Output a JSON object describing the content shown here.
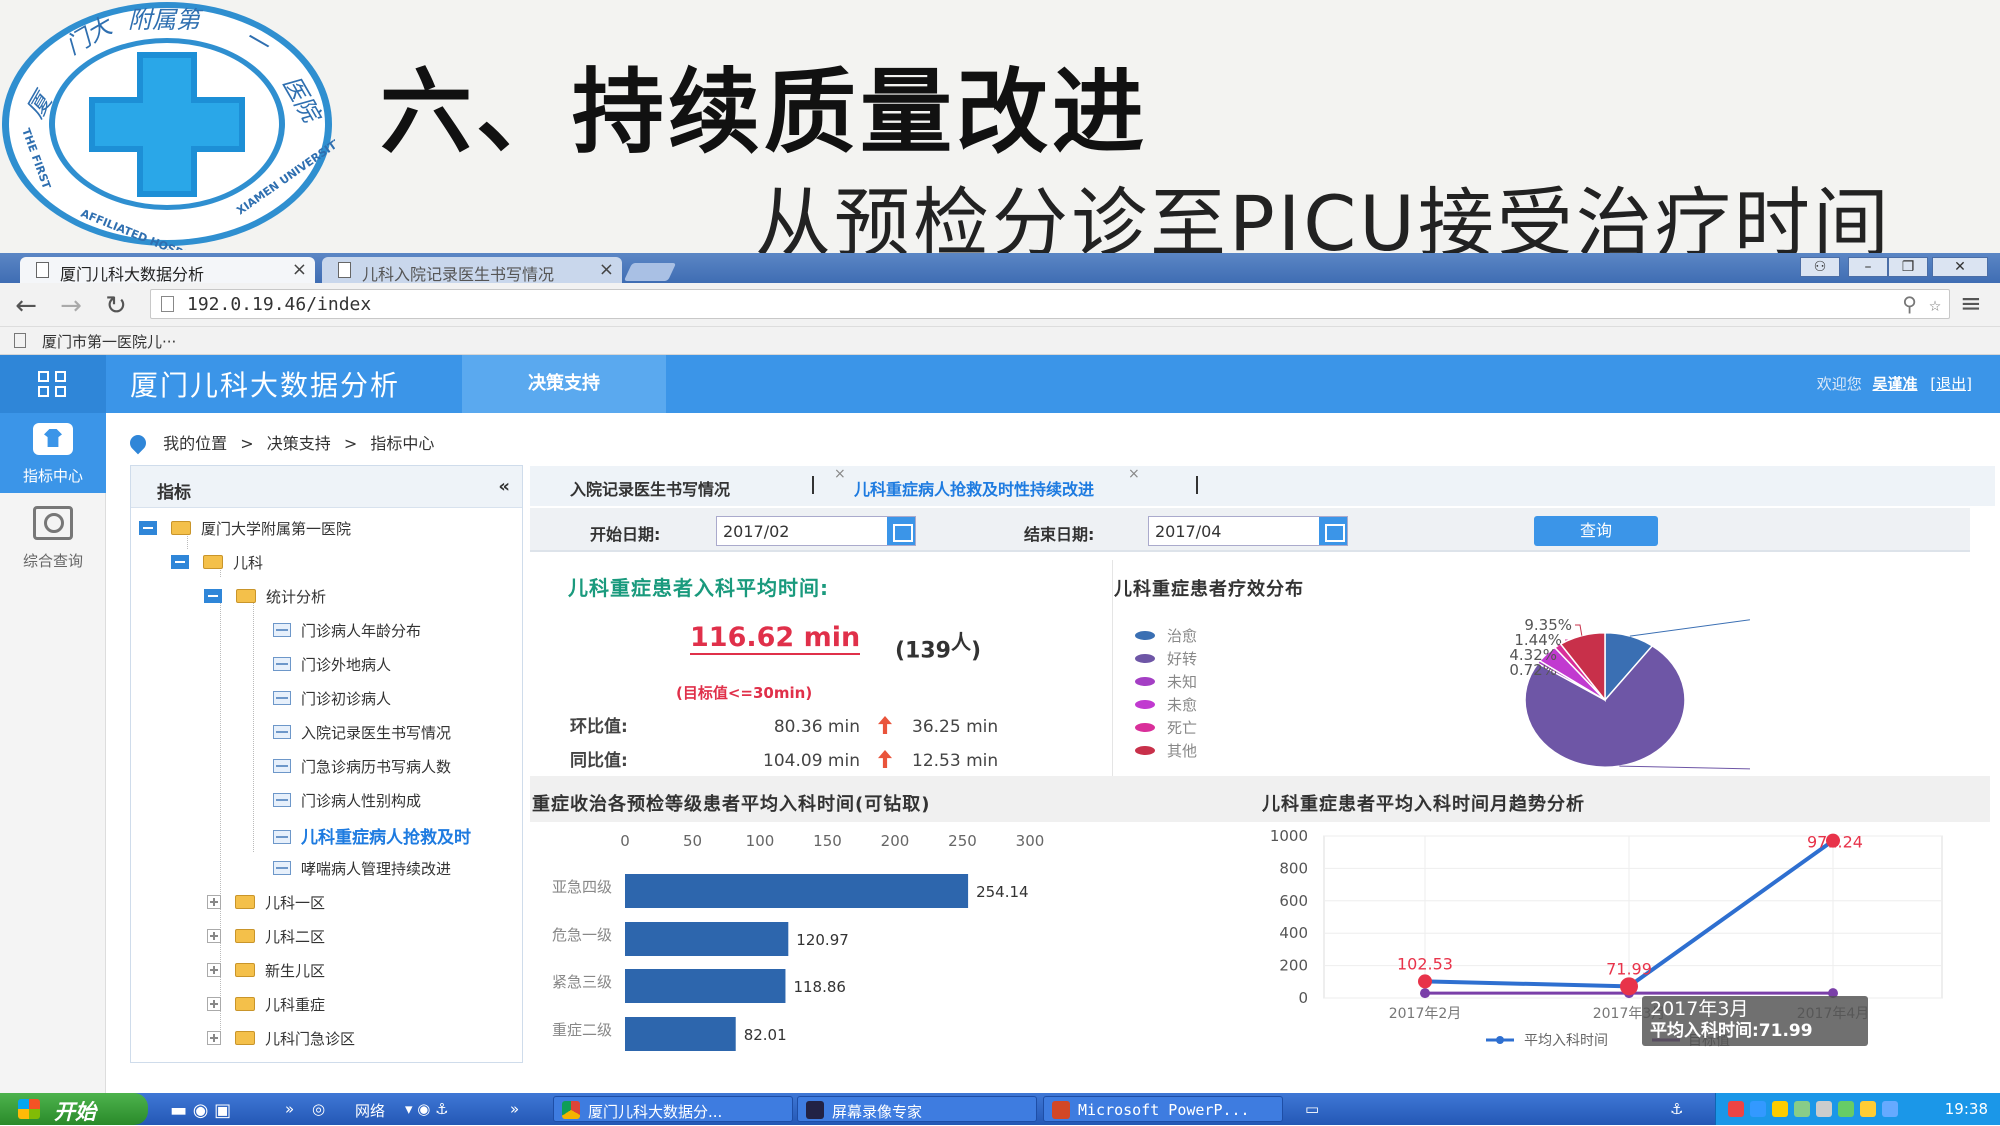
{
  "slide": {
    "title": "六、持续质量改进",
    "subtitle": "从预检分诊至PICU接受治疗时间",
    "logo_text_top": "厦门大学附属第一医院",
    "logo_text_bottom": "THE FIRST AFFILIATED HOSPITAL OF XIAMEN UNIVERSITY"
  },
  "browser": {
    "tabs": [
      {
        "label": "厦门儿科大数据分析",
        "active": true
      },
      {
        "label": "儿科入院记录医生书写情况",
        "active": false
      }
    ],
    "url": "192.0.19.46/index",
    "bookmark": "厦门市第一医院儿···",
    "window_controls": [
      "user-icon",
      "minimize-icon",
      "restore-icon",
      "close-icon"
    ]
  },
  "app": {
    "title": "厦门儿科大数据分析",
    "menu": "决策支持",
    "welcome": "欢迎您",
    "user": "吴谨准",
    "logout": "[退出]",
    "leftnav": [
      {
        "label": "指标中心",
        "icon": "shirt-icon",
        "active": true
      },
      {
        "label": "综合查询",
        "icon": "search-icon",
        "active": false
      }
    ],
    "breadcrumb": [
      "我的位置",
      "决策支持",
      "指标中心"
    ]
  },
  "tree": {
    "header": "指标",
    "collapse": "«",
    "nodes": {
      "root": "厦门大学附属第一医院",
      "pediatrics": "儿科",
      "stats": "统计分析",
      "leaves": [
        "门诊病人年龄分布",
        "门诊外地病人",
        "门诊初诊病人",
        "入院记录医生书写情况",
        "门急诊病历书写病人数",
        "门诊病人性别构成",
        "儿科重症病人抢救及时",
        "哮喘病人管理持续改进"
      ],
      "folders": [
        "儿科一区",
        "儿科二区",
        "新生儿区",
        "儿科重症",
        "儿科门急诊区"
      ]
    }
  },
  "content": {
    "tabs": [
      "入院记录医生书写情况",
      "儿科重症病人抢救及时性持续改进"
    ],
    "tab_close": "×",
    "filters": {
      "start_label": "开始日期:",
      "start_value": "2017/02",
      "end_label": "结束日期:",
      "end_value": "2017/04",
      "query": "查询"
    },
    "kpi": {
      "title": "儿科重症患者入科平均时间:",
      "value": "116.62 min",
      "count": "(139",
      "count_unit": "人",
      "count_close": ")",
      "target": "(目标值<=30min)",
      "mom_label": "环比值:",
      "mom_value": "80.36 min",
      "mom_delta": "36.25 min",
      "yoy_label": "同比值:",
      "yoy_value": "104.09 min",
      "yoy_delta": "12.53 min"
    },
    "pie_title": "儿科重症患者疗效分布",
    "bar_title": "重症收治各预检等级患者平均入科时间(可钻取)",
    "line_title": "儿科重症患者平均入科时间月趋势分析",
    "tooltip": {
      "line1": "2017年3月",
      "line2": "平均入科时间:71.99"
    }
  },
  "chart_data": [
    {
      "type": "pie",
      "title": "儿科重症患者疗效分布",
      "legend_position": "left",
      "slices": [
        {
          "label": "治愈",
          "value": 10.07,
          "display": "10.07%",
          "color": "#3a6fb3"
        },
        {
          "label": "好转",
          "value": 74.1,
          "display": "74.10%",
          "color": "#6e56a6"
        },
        {
          "label": "未知",
          "value": 0.72,
          "display": "0.72%",
          "color": "#a43fc4"
        },
        {
          "label": "未愈",
          "value": 4.32,
          "display": "4.32%",
          "color": "#c13ad0"
        },
        {
          "label": "死亡",
          "value": 1.44,
          "display": "1.44%",
          "color": "#d92f9a"
        },
        {
          "label": "其他",
          "value": 9.35,
          "display": "9.35%",
          "color": "#c8304a"
        }
      ]
    },
    {
      "type": "bar",
      "orientation": "horizontal",
      "title": "重症收治各预检等级患者平均入科时间(可钻取)",
      "categories": [
        "亚急四级",
        "危急一级",
        "紧急三级",
        "重症二级"
      ],
      "values": [
        254.14,
        120.97,
        118.86,
        82.01
      ],
      "xlim": [
        0,
        300
      ],
      "xticks": [
        0,
        50,
        100,
        150,
        200,
        250,
        300
      ],
      "color": "#2d66ad"
    },
    {
      "type": "line",
      "title": "儿科重症患者平均入科时间月趋势分析",
      "categories": [
        "2017年2月",
        "2017年3月",
        "2017年4月"
      ],
      "series": [
        {
          "name": "平均入科时间",
          "values": [
            102.53,
            71.99,
            971.24
          ],
          "color": "#2e6fd0",
          "labels": [
            "102.53",
            "71.99",
            "971.24"
          ]
        },
        {
          "name": "目标值",
          "values": [
            30,
            30,
            30
          ],
          "color": "#7a3fa8"
        }
      ],
      "ylim": [
        0,
        1000
      ],
      "yticks": [
        0,
        200,
        400,
        600,
        800,
        1000
      ],
      "grid": true,
      "legend_position": "bottom"
    }
  ],
  "taskbar": {
    "start": "开始",
    "network": "网络",
    "items": [
      "厦门儿科大数据分...",
      "屏幕录像专家",
      "Microsoft PowerP..."
    ],
    "clock": "19:38"
  }
}
